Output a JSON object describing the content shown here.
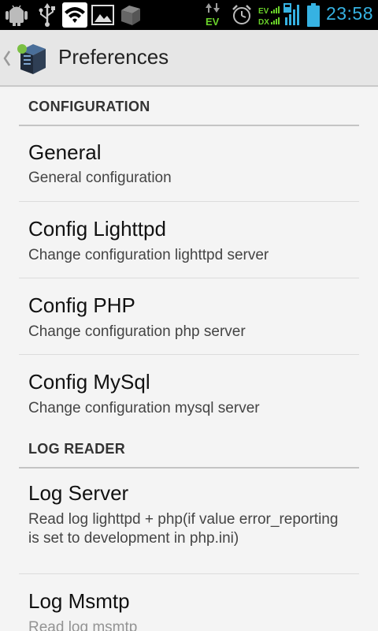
{
  "status_bar": {
    "time": "23:58",
    "time_color": "#36b2e2",
    "icons": [
      "android-debug-icon",
      "usb-icon",
      "wifi-icon",
      "image-icon",
      "storage-icon",
      "data-transfer-icon",
      "alarm-icon",
      "signal-ev-dx-icon",
      "signal-bars-icon",
      "battery-icon"
    ],
    "data_badge": "EV",
    "signal_labels": [
      "EV",
      "DX"
    ]
  },
  "action_bar": {
    "title": "Preferences"
  },
  "categories": [
    {
      "label": "CONFIGURATION"
    },
    {
      "label": "LOG READER"
    }
  ],
  "preferences": [
    {
      "title": "General",
      "summary": "General configuration"
    },
    {
      "title": "Config Lighttpd",
      "summary": "Change configuration lighttpd server"
    },
    {
      "title": "Config PHP",
      "summary": "Change configuration php server"
    },
    {
      "title": "Config MySql",
      "summary": "Change configuration mysql server"
    },
    {
      "title": "Log Server",
      "summary": "Read log lighttpd + php(if value error_reporting is set to development in php.ini)"
    },
    {
      "title": "Log Msmtp",
      "summary": "Read log msmtp"
    }
  ]
}
